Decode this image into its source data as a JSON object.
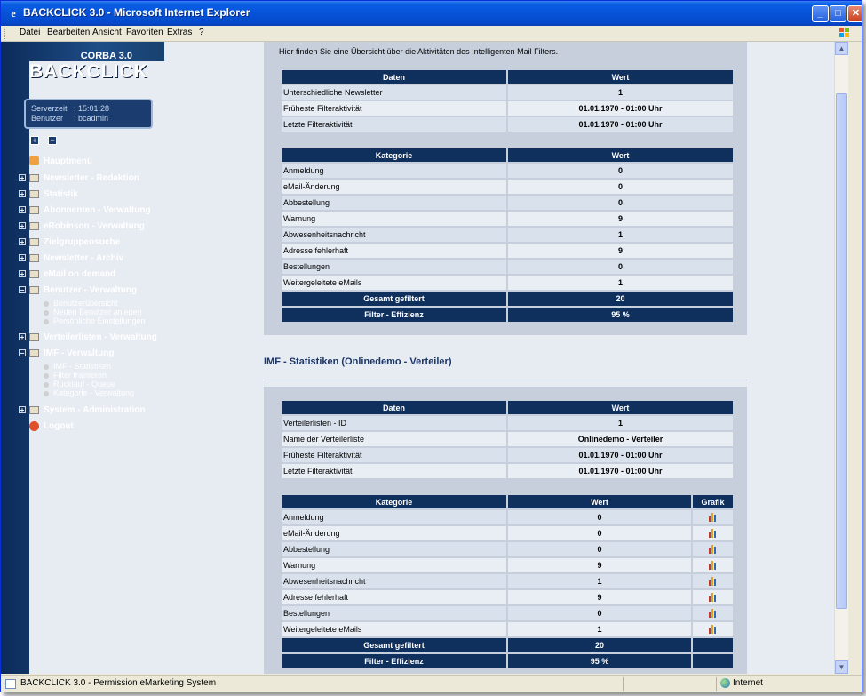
{
  "window": {
    "title": "BACKCLICK 3.0 - Microsoft Internet Explorer",
    "buttons": {
      "minimize": "_",
      "maximize": "□",
      "close": "✕"
    }
  },
  "menu": [
    "Datei",
    "Bearbeiten",
    "Ansicht",
    "Favoriten",
    "Extras",
    "?"
  ],
  "logo": {
    "top": "CORBA 3.0",
    "main": "BACKCLICK"
  },
  "serverinfo": {
    "time_label": "Serverzeit",
    "time_value": ": 15:01:28",
    "user_label": "Benutzer",
    "user_value": ": bcadmin"
  },
  "nav": {
    "home": "Hauptmenü",
    "items": [
      "Newsletter - Redaktion",
      "Statistik",
      "Abonnenten - Verwaltung",
      "eRobinson - Verwaltung",
      "Zielgruppensuche",
      "Newsletter - Archiv",
      "eMail on demand",
      "Benutzer - Verwaltung",
      "Verteilerlisten - Verwaltung",
      "IMF - Verwaltung",
      "System - Administration"
    ],
    "benutzer_sub": [
      "Benutzerübersicht",
      "Neuen Benutzer anlegen",
      "Persönliche Einstellungen"
    ],
    "imf_sub": [
      "IMF - Statistiken",
      "Filter trainieren",
      "Rücklauf - Queue",
      "Kategorie - Verwaltung"
    ],
    "logout": "Logout"
  },
  "panel1": {
    "intro": "Hier finden Sie eine Übersicht über die Aktivitäten des Intelligenten Mail Filters.",
    "info_headers": [
      "Daten",
      "Wert"
    ],
    "info_rows": [
      [
        "Unterschiedliche Newsletter",
        "1"
      ],
      [
        "Früheste Filteraktivität",
        "01.01.1970 - 01:00 Uhr"
      ],
      [
        "Letzte Filteraktivität",
        "01.01.1970 - 01:00 Uhr"
      ]
    ],
    "cat_headers": [
      "Kategorie",
      "Wert"
    ],
    "cat_rows": [
      [
        "Anmeldung",
        "0"
      ],
      [
        "eMail-Änderung",
        "0"
      ],
      [
        "Abbestellung",
        "0"
      ],
      [
        "Warnung",
        "9"
      ],
      [
        "Abwesenheitsnachricht",
        "1"
      ],
      [
        "Adresse fehlerhaft",
        "9"
      ],
      [
        "Bestellungen",
        "0"
      ],
      [
        "Weitergeleitete eMails",
        "1"
      ]
    ],
    "totals": [
      [
        "Gesamt gefiltert",
        "20"
      ],
      [
        "Filter - Effizienz",
        "95 %"
      ]
    ]
  },
  "section2": {
    "title": "IMF - Statistiken (Onlinedemo - Verteiler)"
  },
  "panel2": {
    "info_headers": [
      "Daten",
      "Wert"
    ],
    "info_rows": [
      [
        "Verteilerlisten - ID",
        "1"
      ],
      [
        "Name der Verteilerliste",
        "Onlinedemo - Verteiler"
      ],
      [
        "Früheste Filteraktivität",
        "01.01.1970 - 01:00 Uhr"
      ],
      [
        "Letzte Filteraktivität",
        "01.01.1970 - 01:00 Uhr"
      ]
    ],
    "cat_headers": [
      "Kategorie",
      "Wert",
      "Grafik"
    ],
    "cat_rows": [
      [
        "Anmeldung",
        "0"
      ],
      [
        "eMail-Änderung",
        "0"
      ],
      [
        "Abbestellung",
        "0"
      ],
      [
        "Warnung",
        "9"
      ],
      [
        "Abwesenheitsnachricht",
        "1"
      ],
      [
        "Adresse fehlerhaft",
        "9"
      ],
      [
        "Bestellungen",
        "0"
      ],
      [
        "Weitergeleitete eMails",
        "1"
      ]
    ],
    "totals": [
      [
        "Gesamt gefiltert",
        "20"
      ],
      [
        "Filter - Effizienz",
        "95 %"
      ]
    ]
  },
  "status": {
    "text": "BACKCLICK 3.0 - Permission eMarketing System",
    "zone": "Internet"
  },
  "colors": {
    "header": "#0f2f5d",
    "row_odd": "#d9e2ec",
    "row_even": "#e9eef4",
    "sidebar": "#1e4d87"
  }
}
